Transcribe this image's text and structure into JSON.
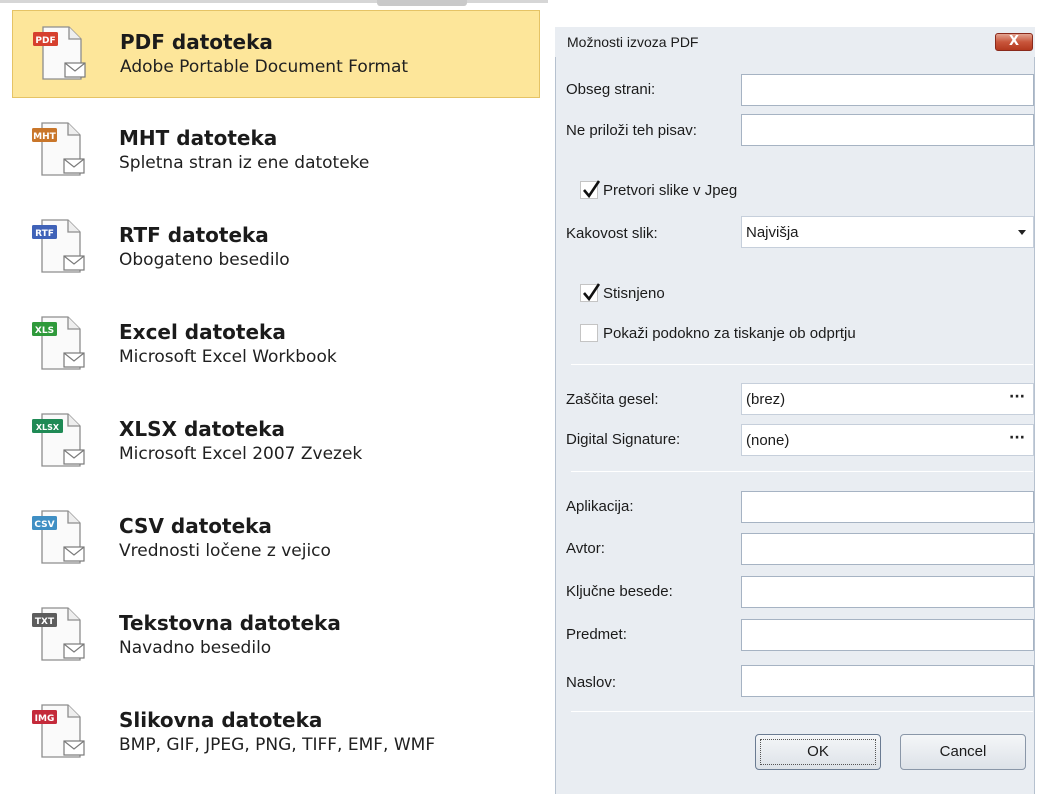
{
  "formats": [
    {
      "badge": "PDF",
      "badge_color": "#d6402e",
      "title": "PDF datoteka",
      "description": "Adobe Portable Document Format",
      "selected": true
    },
    {
      "badge": "MHT",
      "badge_color": "#c9762a",
      "title": "MHT datoteka",
      "description": "Spletna stran iz ene datoteke",
      "selected": false
    },
    {
      "badge": "RTF",
      "badge_color": "#3f62b8",
      "title": "RTF datoteka",
      "description": "Obogateno besedilo",
      "selected": false
    },
    {
      "badge": "XLS",
      "badge_color": "#2f9a3b",
      "title": "Excel datoteka",
      "description": "Microsoft Excel Workbook",
      "selected": false
    },
    {
      "badge": "XLSX",
      "badge_color": "#1f8a55",
      "title": "XLSX datoteka",
      "description": "Microsoft Excel 2007 Zvezek",
      "selected": false
    },
    {
      "badge": "CSV",
      "badge_color": "#3f8fc4",
      "title": "CSV datoteka",
      "description": "Vrednosti ločene z vejico",
      "selected": false
    },
    {
      "badge": "TXT",
      "badge_color": "#5d5d5d",
      "title": "Tekstovna datoteka",
      "description": "Navadno besedilo",
      "selected": false
    },
    {
      "badge": "IMG",
      "badge_color": "#c42a3a",
      "title": "Slikovna datoteka",
      "description": "BMP, GIF, JPEG, PNG, TIFF, EMF, WMF",
      "selected": false
    }
  ],
  "icon_name": "file-envelope-icon",
  "dialog": {
    "title": "Možnosti izvoza PDF",
    "close_label": "X",
    "page_range": {
      "label": "Obseg strani:",
      "value": ""
    },
    "exclude_fonts": {
      "label": "Ne priloži teh pisav:",
      "value": ""
    },
    "convert_jpeg": {
      "label": "Pretvori slike v Jpeg",
      "checked": true
    },
    "image_quality": {
      "label": "Kakovost slik:",
      "value": "Najvišja"
    },
    "compressed": {
      "label": "Stisnjeno",
      "checked": true
    },
    "show_print": {
      "label": "Pokaži podokno za tiskanje ob odprtju",
      "checked": false
    },
    "password": {
      "label": "Zaščita gesel:",
      "value": "(brez)",
      "button": "···"
    },
    "signature": {
      "label": "Digital Signature:",
      "value": "(none)",
      "button": "···"
    },
    "application": {
      "label": "Aplikacija:",
      "value": ""
    },
    "author": {
      "label": "Avtor:",
      "value": ""
    },
    "keywords": {
      "label": "Ključne besede:",
      "value": ""
    },
    "subject": {
      "label": "Predmet:",
      "value": ""
    },
    "doc_title": {
      "label": "Naslov:",
      "value": ""
    },
    "ok_label": "OK",
    "cancel_label": "Cancel"
  },
  "colors": {
    "selected_bg": "#fde69a",
    "dialog_bg": "#e9edf2",
    "close_button": "#c8553b"
  }
}
